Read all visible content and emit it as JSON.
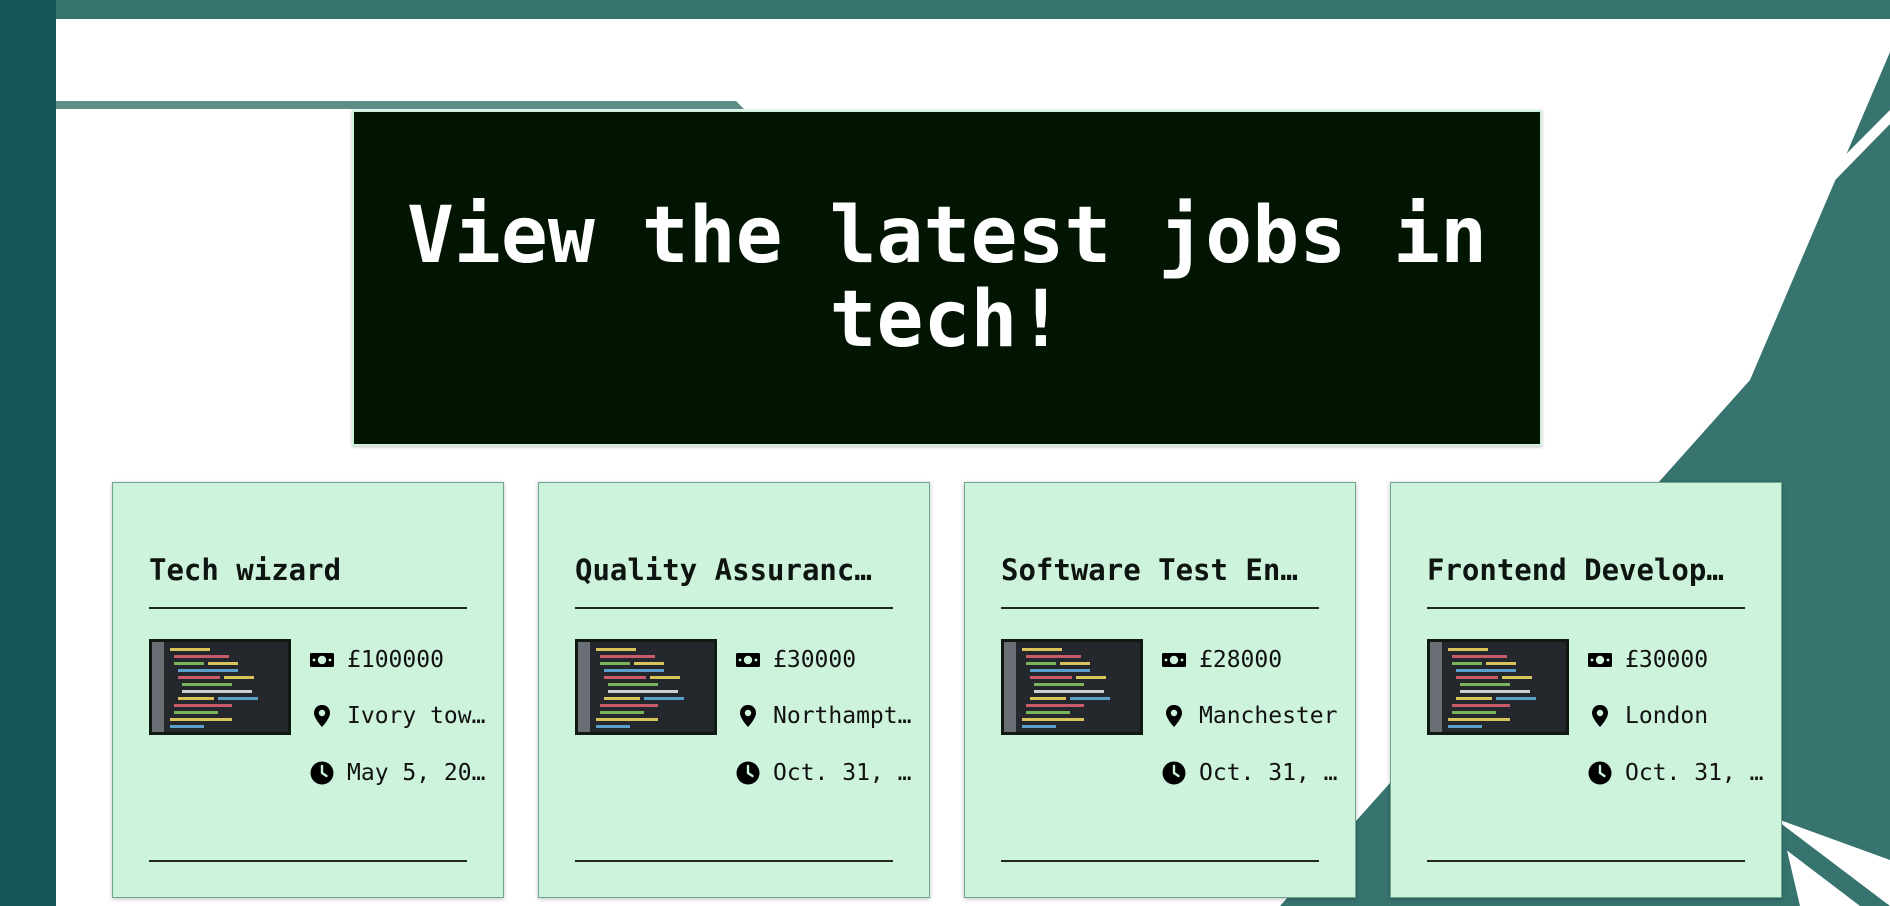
{
  "banner": {
    "title": "View the latest jobs in tech!"
  },
  "jobs": [
    {
      "title": "Tech wizard",
      "salary": "£100000",
      "location": "Ivory tow…",
      "date": "May 5, 20…"
    },
    {
      "title": "Quality Assuranc…",
      "salary": "£30000",
      "location": "Northampt…",
      "date": "Oct. 31, …"
    },
    {
      "title": "Software Test En…",
      "salary": "£28000",
      "location": "Manchester",
      "date": "Oct. 31, …"
    },
    {
      "title": "Frontend Develop…",
      "salary": "£30000",
      "location": "London",
      "date": "Oct. 31, …"
    }
  ],
  "icons": {
    "salary": "money-icon",
    "location": "map-pin-icon",
    "date": "clock-icon"
  },
  "colors": {
    "banner": "#021402",
    "card": "#cdf3dc",
    "accent": "#37736f",
    "sidebar": "#14565a"
  }
}
